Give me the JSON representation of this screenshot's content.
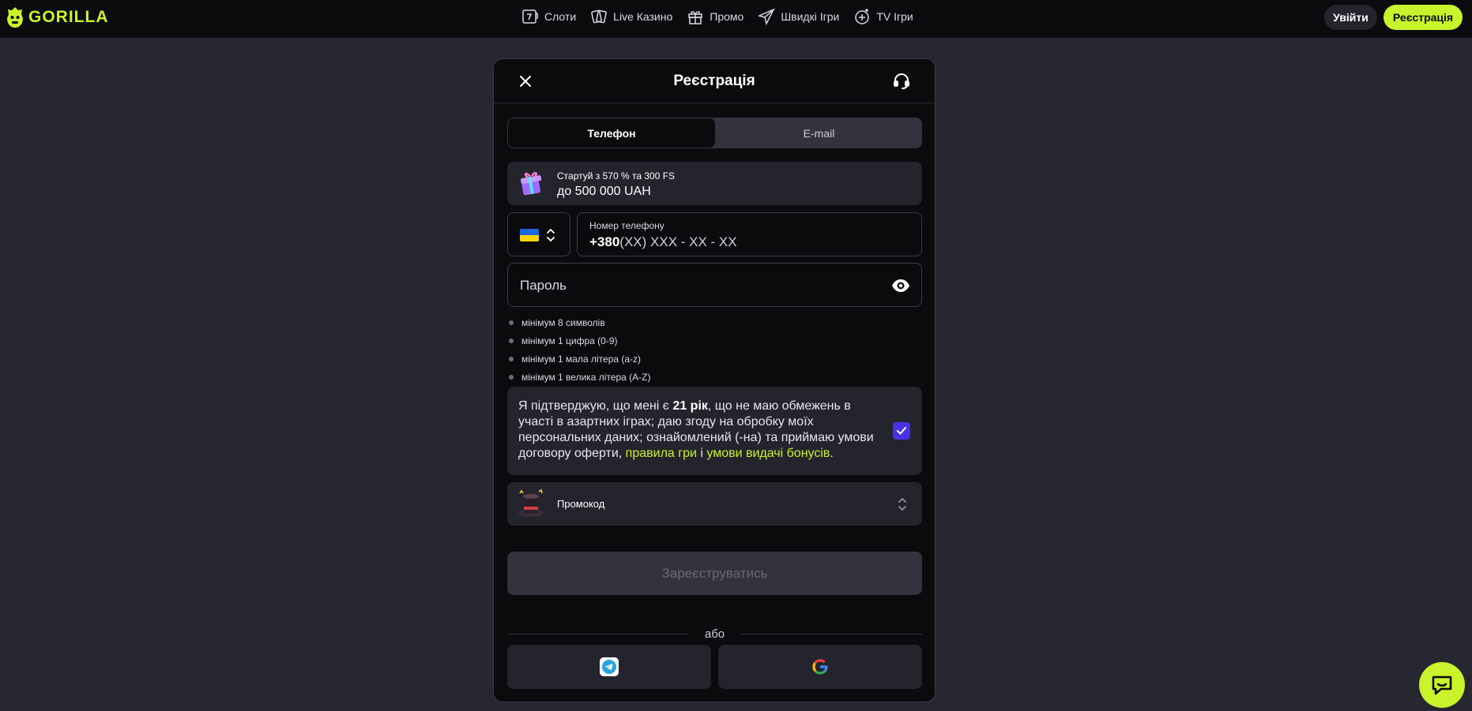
{
  "header": {
    "logo_text": "GORILLA",
    "nav": [
      {
        "label": "Слоти",
        "icon": "slot-icon"
      },
      {
        "label": "Live Казино",
        "icon": "cards-icon"
      },
      {
        "label": "Промо",
        "icon": "gift-icon"
      },
      {
        "label": "Швидкі Ігри",
        "icon": "plane-icon"
      },
      {
        "label": "TV Ігри",
        "icon": "tv-games-icon"
      }
    ],
    "login_label": "Увійти",
    "register_label": "Реєстрація"
  },
  "modal": {
    "title": "Реєстрація",
    "tabs": {
      "phone": "Телефон",
      "email": "E-mail"
    },
    "bonus": {
      "line1": "Стартуй з 570 % та 300 FS",
      "line2": "до 500 000 UAH"
    },
    "phone": {
      "label": "Номер телефону",
      "prefix": "+380",
      "mask": "(XX) XXX - XX - XX"
    },
    "password": {
      "placeholder": "Пароль"
    },
    "rules": [
      "мінімум 8 символів",
      "мінімум 1 цифра (0-9)",
      "мінімум 1 мала літера (a-z)",
      "мінімум 1 велика літера (A-Z)"
    ],
    "consent": {
      "part1": "Я підтверджую, що мені є ",
      "age": "21 рік",
      "part2": ", що не маю обмежень в участі в азартних іграх; даю згоду на обробку моїх персональних даних; ознайомлений (-на) та приймаю умови договору оферти, ",
      "link1": "правила гри",
      "part3": " і ",
      "link2": "умови видачі бонусів",
      "part4": ".",
      "checked": true
    },
    "promo_label": "Промокод",
    "submit_label": "Зареєструватись",
    "divider_text": "або"
  },
  "colors": {
    "accent": "#c9f32b",
    "background": "#272731",
    "panel": "#0b0b0e",
    "checkbox": "#4633e6"
  }
}
